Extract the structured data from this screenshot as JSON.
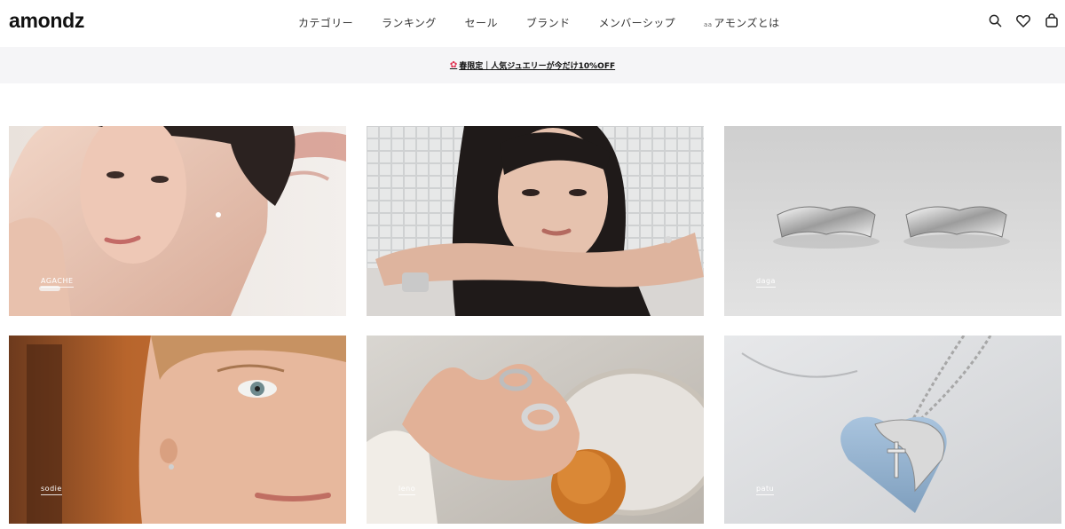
{
  "header": {
    "logo": "amondz",
    "nav": [
      {
        "label": "カテゴリー"
      },
      {
        "label": "ランキング"
      },
      {
        "label": "セール"
      },
      {
        "label": "ブランド"
      },
      {
        "label": "メンバーシップ"
      },
      {
        "prefix": "aa",
        "label": "アモンズとは"
      }
    ],
    "icons": [
      "search-icon",
      "heart-icon",
      "bag-icon"
    ]
  },
  "announcement": {
    "icon": "star-icon",
    "text": "春限定｜人気ジュエリーが今だけ10%OFF"
  },
  "tiles": [
    {
      "label": "AGACHE"
    },
    {
      "label": ""
    },
    {
      "label": "daga"
    },
    {
      "label": "sodie"
    },
    {
      "label": "leno"
    },
    {
      "label": "patu"
    }
  ],
  "colors": {
    "accent_star": "#e03050",
    "announcement_bg": "#f5f5f7"
  }
}
